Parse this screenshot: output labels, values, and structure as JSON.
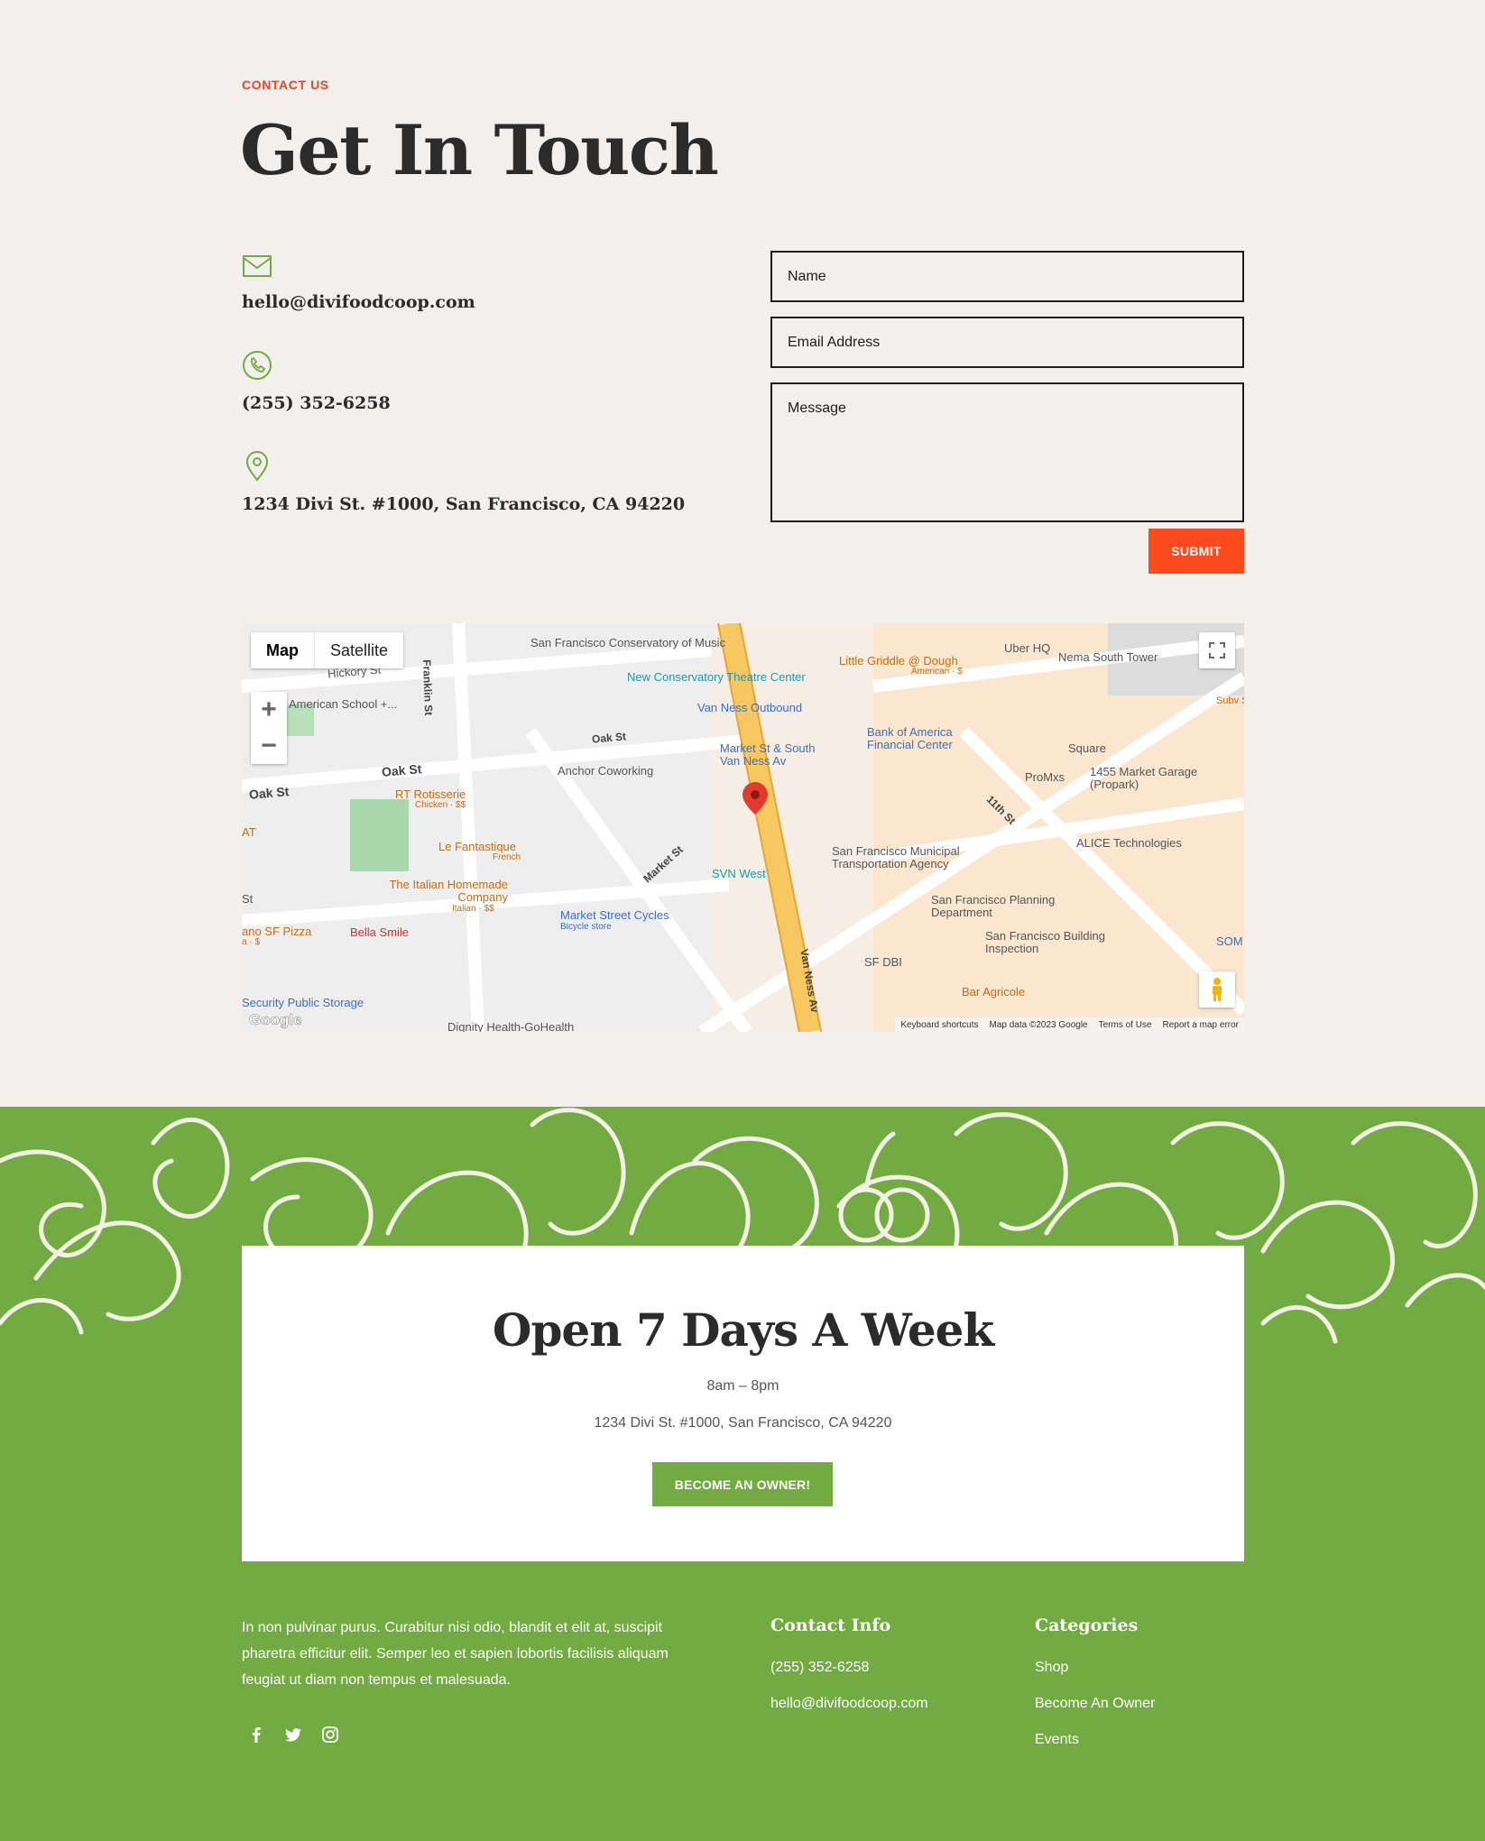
{
  "header": {
    "eyebrow": "CONTACT US",
    "title": "Get In Touch"
  },
  "contact": {
    "email": "hello@divifoodcoop.com",
    "phone": "(255) 352-6258",
    "address": "1234 Divi St. #1000, San Francisco, CA 94220",
    "icons": [
      "envelope-icon",
      "phone-icon",
      "location-pin-icon"
    ]
  },
  "form": {
    "name_placeholder": "Name",
    "email_placeholder": "Email Address",
    "message_placeholder": "Message",
    "submit_label": "SUBMIT"
  },
  "map": {
    "type_map": "Map",
    "type_satellite": "Satellite",
    "zoom_in": "+",
    "zoom_out": "−",
    "google": "Google",
    "footer": {
      "shortcuts": "Keyboard shortcuts",
      "data": "Map data ©2023 Google",
      "terms": "Terms of Use",
      "report": "Report a map error"
    },
    "labels": {
      "hickory": "Hickory St",
      "american_school": "American School +...",
      "franklin": "Franklin St",
      "sfcm": "San Francisco Conservatory of Music",
      "new_conservatory": "New Conservatory Theatre Center",
      "van_ness_outbound": "Van Ness Outbound",
      "little_griddle": "Little Griddle @ Dough",
      "little_griddle_sub": "American · $",
      "uber": "Uber HQ",
      "nema": "Nema South Tower",
      "subway": "Subv Sandwicl",
      "oak1": "Oak St",
      "oak2": "Oak St",
      "oak3": "Oak St",
      "anchor": "Anchor Coworking",
      "market_south": "Market St & South Van Ness Av",
      "boa": "Bank of America Financial Center",
      "square": "Square",
      "promxs": "ProMxs",
      "garage": "1455 Market Garage (Propark)",
      "rt": "RT Rotisserie",
      "rt_sub": "Chicken · $$",
      "eleventh": "11th St",
      "at": "AT",
      "fantastique": "Le Fantastique",
      "fantastique_sub": "French",
      "market_st": "Market St",
      "svn_west": "SVN West",
      "sfmta": "San Francisco Municipal Transportation Agency",
      "alice": "ALICE Technologies",
      "italian": "The Italian Homemade Company",
      "italian_sub": "Italian · $$",
      "st": "St",
      "sf_pizza": "ano SF Pizza",
      "sf_pizza_sub": "a · $",
      "bella": "Bella Smile",
      "market_cycles": "Market Street Cycles",
      "market_cycles_sub": "Bicycle store",
      "planning": "San Francisco Planning Department",
      "building": "San Francisco Building Inspection",
      "som": "SOM",
      "van_ness_av": "Van Ness Av",
      "sfdbi": "SF DBI",
      "bar_agricole": "Bar Agricole",
      "storage": "Security Public Storage",
      "dignity": "Dignity Health-GoHealth"
    }
  },
  "hours": {
    "title": "Open 7 Days A Week",
    "time": "8am – 8pm",
    "address": "1234 Divi St. #1000, San Francisco, CA 94220",
    "cta": "BECOME AN OWNER!"
  },
  "footer": {
    "blurb": "In non pulvinar purus. Curabitur nisi odio, blandit et elit at, suscipit pharetra efficitur elit. Semper leo et sapien lobortis facilisis aliquam feugiat ut diam non tempus et malesuada.",
    "contact_heading": "Contact Info",
    "phone": "(255) 352-6258",
    "email": "hello@divifoodcoop.com",
    "categories_heading": "Categories",
    "categories": [
      "Shop",
      "Become An Owner",
      "Events"
    ],
    "social": [
      "facebook-icon",
      "twitter-icon",
      "instagram-icon"
    ]
  },
  "colors": {
    "accent_orange": "#fc4a1f",
    "eyebrow_red": "#e8482b",
    "brand_green": "#72ab42",
    "page_bg": "#f3efec",
    "text_dark": "#2b2b2b"
  }
}
